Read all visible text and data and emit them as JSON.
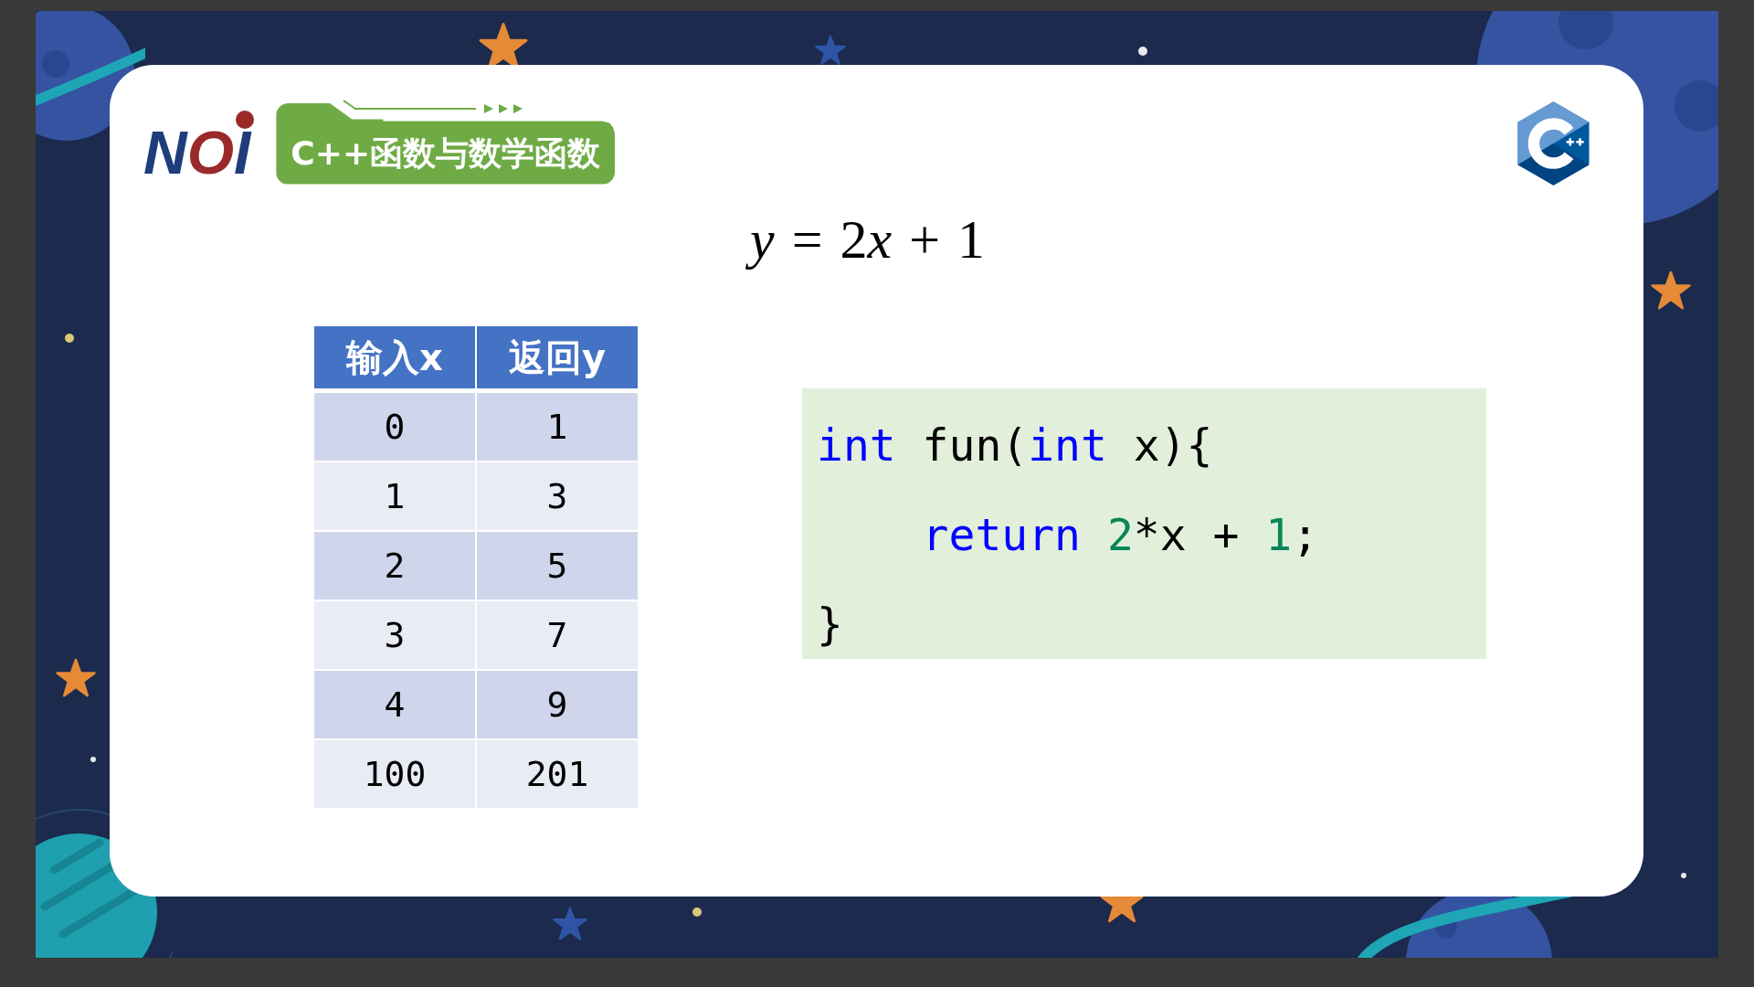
{
  "slide": {
    "logo": {
      "text": "NOI"
    },
    "title": "C++函数与数学函数",
    "formula": [
      {
        "text": "y",
        "kind": "variable"
      },
      {
        "text": " = 2",
        "kind": "plain"
      },
      {
        "text": "x",
        "kind": "variable"
      },
      {
        "text": " + 1",
        "kind": "plain"
      }
    ],
    "table": {
      "columns": [
        "输入x",
        "返回y"
      ],
      "rows": [
        [
          "0",
          "1"
        ],
        [
          "1",
          "3"
        ],
        [
          "2",
          "5"
        ],
        [
          "3",
          "7"
        ],
        [
          "4",
          "9"
        ],
        [
          "100",
          "201"
        ]
      ]
    },
    "code": {
      "lines": [
        [
          {
            "text": "int",
            "kind": "keyword"
          },
          {
            "text": " fun(",
            "kind": "plain"
          },
          {
            "text": "int",
            "kind": "keyword"
          },
          {
            "text": " x){",
            "kind": "plain"
          }
        ],
        [
          {
            "text": "    return",
            "kind": "keyword"
          },
          {
            "text": " 2",
            "kind": "number"
          },
          {
            "text": "*x + ",
            "kind": "plain"
          },
          {
            "text": "1",
            "kind": "number"
          },
          {
            "text": ";",
            "kind": "plain"
          }
        ],
        [
          {
            "text": "}",
            "kind": "plain"
          }
        ]
      ]
    }
  }
}
